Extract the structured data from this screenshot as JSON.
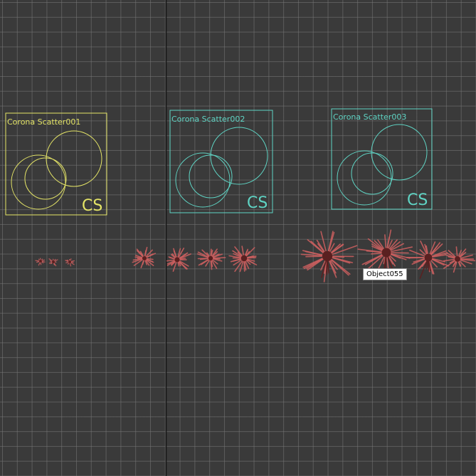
{
  "scene": {
    "colors": {
      "background": "#3a3a3a",
      "grid": "#6f6f6f",
      "axis": "#141414",
      "scatter_yellow": "#e5e567",
      "scatter_cyan": "#5fd4c4",
      "plant": "#d06060",
      "plant_dark": "#5a2020"
    },
    "scatters": [
      {
        "name": "Corona  Scatter001",
        "icon_text": "CS",
        "color": "yellow"
      },
      {
        "name": "Corona  Scatter002",
        "icon_text": "CS",
        "color": "cyan"
      },
      {
        "name": "Corona  Scatter003",
        "icon_text": "CS",
        "color": "cyan"
      }
    ],
    "tooltip": {
      "text": "Object055"
    }
  }
}
